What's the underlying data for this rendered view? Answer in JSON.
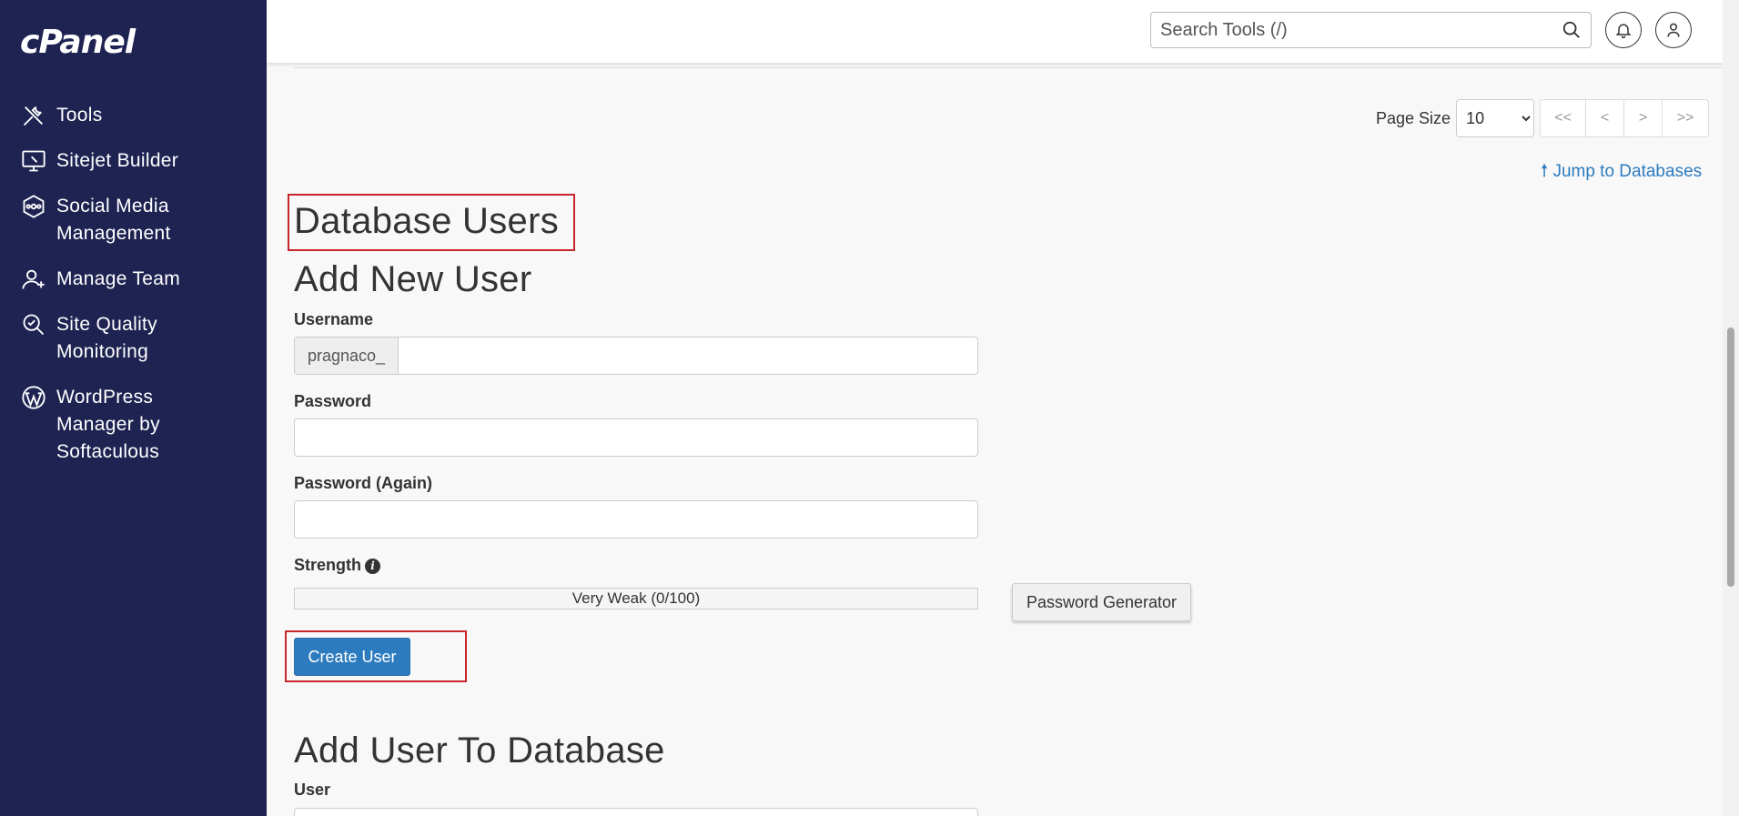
{
  "sidebar": {
    "logo": "cPanel",
    "items": [
      {
        "label": "Tools",
        "icon": "tools-icon"
      },
      {
        "label": "Sitejet Builder",
        "icon": "monitor-icon"
      },
      {
        "label": "Social Media\nManagement",
        "icon": "social-hub-icon"
      },
      {
        "label": "Manage Team",
        "icon": "team-icon"
      },
      {
        "label": "Site Quality\nMonitoring",
        "icon": "magnifier-icon"
      },
      {
        "label": "WordPress\nManager by\nSoftaculous",
        "icon": "wordpress-icon"
      }
    ]
  },
  "topbar": {
    "search_placeholder": "Search Tools (/)"
  },
  "pager": {
    "label": "Page Size",
    "selected": "10",
    "buttons": [
      "<<",
      "<",
      ">",
      ">>"
    ]
  },
  "jump_link": "Jump to Databases",
  "section_title": "Database Users",
  "add_user": {
    "title": "Add New User",
    "username_label": "Username",
    "username_prefix": "pragnaco_",
    "password_label": "Password",
    "password_again_label": "Password (Again)",
    "strength_label": "Strength",
    "strength_value": "Very Weak (0/100)",
    "generator_label": "Password Generator",
    "create_label": "Create User"
  },
  "add_to_db": {
    "title": "Add User To Database",
    "user_label": "User"
  }
}
